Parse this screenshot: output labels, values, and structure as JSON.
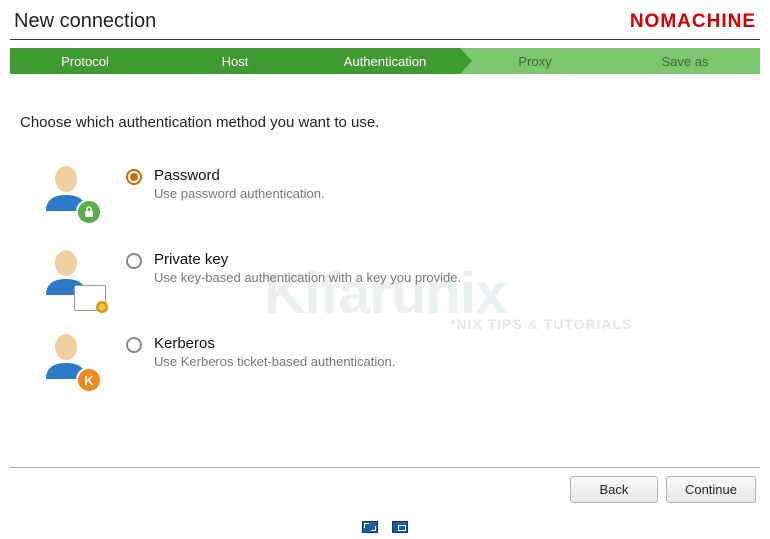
{
  "header": {
    "title": "New connection",
    "brand": "NOMACHINE"
  },
  "steps": [
    {
      "label": "Protocol",
      "state": "done"
    },
    {
      "label": "Host",
      "state": "done"
    },
    {
      "label": "Authentication",
      "state": "active"
    },
    {
      "label": "Proxy",
      "state": "pending"
    },
    {
      "label": "Save as",
      "state": "pending"
    }
  ],
  "prompt": "Choose which authentication method you want to use.",
  "options": [
    {
      "id": "password",
      "title": "Password",
      "desc": "Use password authentication.",
      "selected": true,
      "badge": "lock"
    },
    {
      "id": "private-key",
      "title": "Private key",
      "desc": "Use key-based authentication with a key you provide.",
      "selected": false,
      "badge": "cert"
    },
    {
      "id": "kerberos",
      "title": "Kerberos",
      "desc": "Use Kerberos ticket-based authentication.",
      "selected": false,
      "badge": "kerb"
    }
  ],
  "buttons": {
    "back": "Back",
    "continue": "Continue"
  },
  "watermark": {
    "main": "Kifarunix",
    "sub": "*NIX TIPS & TUTORIALS"
  }
}
